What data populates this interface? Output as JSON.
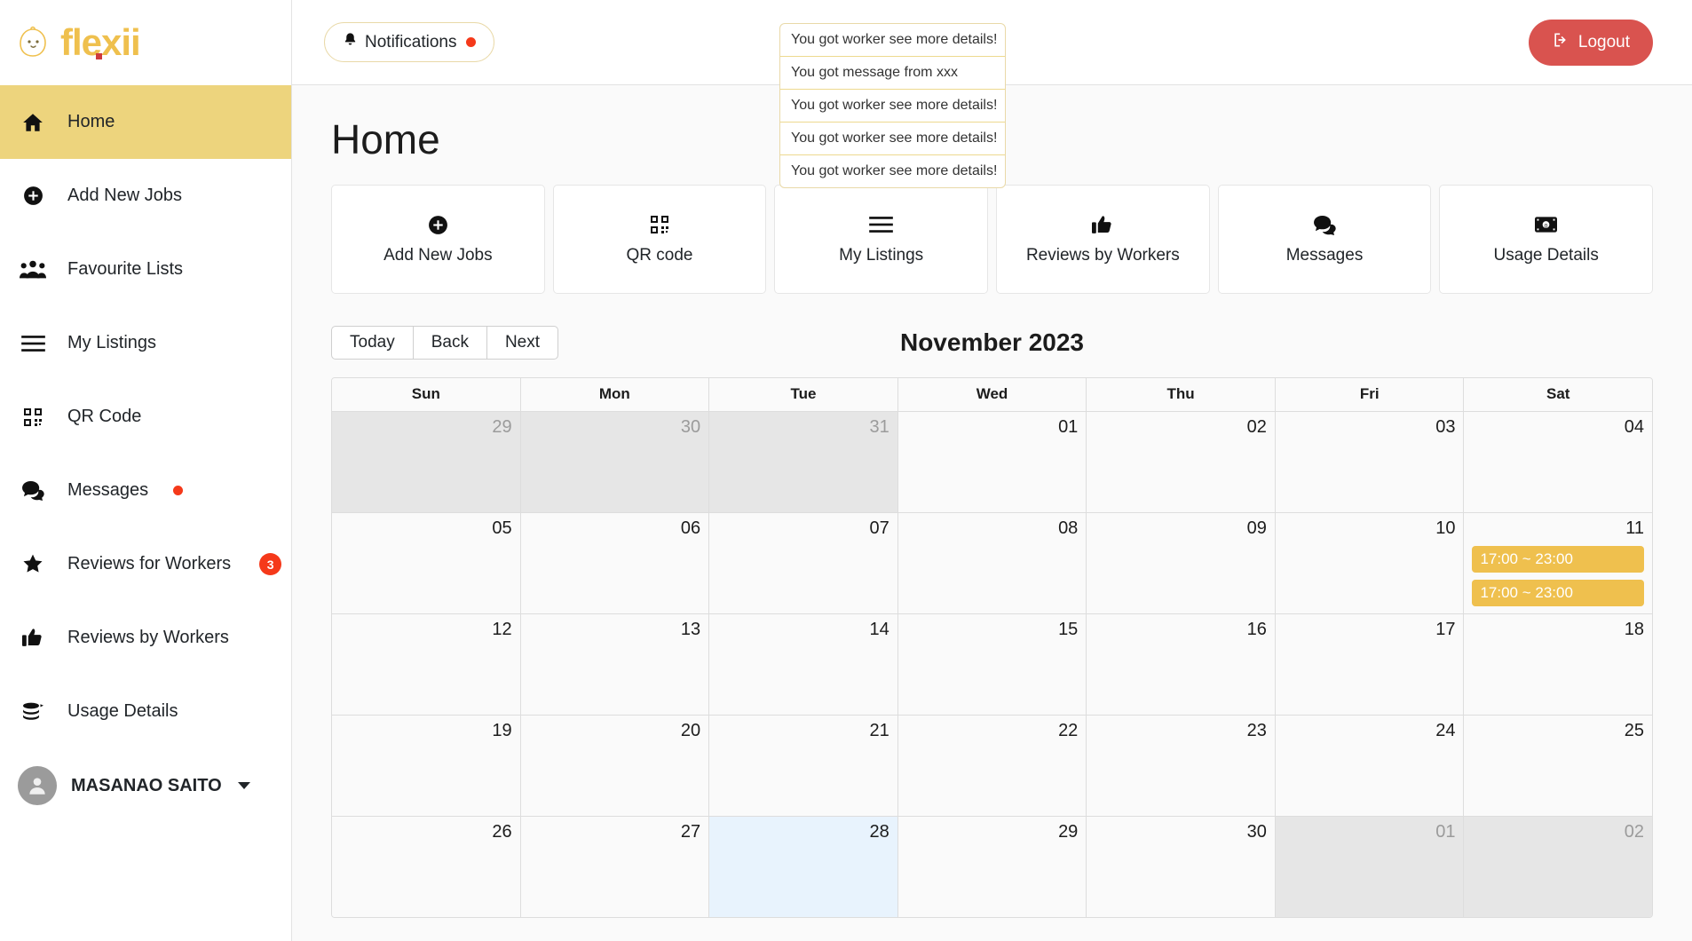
{
  "brand": {
    "name": "flexii",
    "mascot_icon": "chick-icon",
    "accent": "#efc04e",
    "dot_color": "#cf3b3b"
  },
  "sidebar": {
    "items": [
      {
        "label": "Home",
        "icon": "home-icon",
        "active": true
      },
      {
        "label": "Add New Jobs",
        "icon": "plus-circle-icon",
        "active": false
      },
      {
        "label": "Favourite Lists",
        "icon": "people-group-icon",
        "active": false
      },
      {
        "label": "My Listings",
        "icon": "list-lines-icon",
        "active": false
      },
      {
        "label": "QR Code",
        "icon": "qr-code-icon",
        "active": false
      },
      {
        "label": "Messages",
        "icon": "chat-bubbles-icon",
        "active": false,
        "dot": true
      },
      {
        "label": "Reviews for Workers",
        "icon": "star-icon",
        "active": false,
        "badge": "3"
      },
      {
        "label": "Reviews by Workers",
        "icon": "thumbs-up-icon",
        "active": false
      },
      {
        "label": "Usage Details",
        "icon": "coins-icon",
        "active": false
      }
    ],
    "profile": {
      "name": "MASANAO SAITO",
      "avatar_icon": "user-avatar-icon",
      "caret_icon": "caret-down-icon"
    }
  },
  "topbar": {
    "notifications_label": "Notifications",
    "notifications_icon": "bell-icon",
    "notifications_has_unread": true,
    "logout_label": "Logout",
    "logout_icon": "sign-out-icon",
    "logout_color": "#d9534f"
  },
  "notifications": {
    "items": [
      "You got worker see more details!",
      "You got message from xxx",
      "You got worker see more details!",
      "You got worker see more details!",
      "You got worker see more details!"
    ]
  },
  "main": {
    "page_title": "Home",
    "cards": [
      {
        "label": "Add New Jobs",
        "icon": "plus-circle-icon"
      },
      {
        "label": "QR code",
        "icon": "qr-code-icon"
      },
      {
        "label": "My Listings",
        "icon": "list-lines-icon"
      },
      {
        "label": "Reviews by Workers",
        "icon": "thumbs-up-icon"
      },
      {
        "label": "Messages",
        "icon": "chat-bubbles-icon"
      },
      {
        "label": "Usage Details",
        "icon": "money-bill-icon"
      }
    ]
  },
  "calendar": {
    "toolbar": {
      "today": "Today",
      "back": "Back",
      "next": "Next"
    },
    "title": "November 2023",
    "weekdays": [
      "Sun",
      "Mon",
      "Tue",
      "Wed",
      "Thu",
      "Fri",
      "Sat"
    ],
    "event_color": "#efc04e",
    "today_cell_color": "#e8f3fd",
    "weeks": [
      [
        {
          "date": "29",
          "off": true,
          "today": false,
          "events": []
        },
        {
          "date": "30",
          "off": true,
          "today": false,
          "events": []
        },
        {
          "date": "31",
          "off": true,
          "today": false,
          "events": []
        },
        {
          "date": "01",
          "off": false,
          "today": false,
          "events": []
        },
        {
          "date": "02",
          "off": false,
          "today": false,
          "events": []
        },
        {
          "date": "03",
          "off": false,
          "today": false,
          "events": []
        },
        {
          "date": "04",
          "off": false,
          "today": false,
          "events": []
        }
      ],
      [
        {
          "date": "05",
          "off": false,
          "today": false,
          "events": []
        },
        {
          "date": "06",
          "off": false,
          "today": false,
          "events": []
        },
        {
          "date": "07",
          "off": false,
          "today": false,
          "events": []
        },
        {
          "date": "08",
          "off": false,
          "today": false,
          "events": []
        },
        {
          "date": "09",
          "off": false,
          "today": false,
          "events": []
        },
        {
          "date": "10",
          "off": false,
          "today": false,
          "events": []
        },
        {
          "date": "11",
          "off": false,
          "today": false,
          "events": [
            "17:00 ~ 23:00",
            "17:00 ~ 23:00"
          ]
        }
      ],
      [
        {
          "date": "12",
          "off": false,
          "today": false,
          "events": []
        },
        {
          "date": "13",
          "off": false,
          "today": false,
          "events": []
        },
        {
          "date": "14",
          "off": false,
          "today": false,
          "events": []
        },
        {
          "date": "15",
          "off": false,
          "today": false,
          "events": []
        },
        {
          "date": "16",
          "off": false,
          "today": false,
          "events": []
        },
        {
          "date": "17",
          "off": false,
          "today": false,
          "events": []
        },
        {
          "date": "18",
          "off": false,
          "today": false,
          "events": []
        }
      ],
      [
        {
          "date": "19",
          "off": false,
          "today": false,
          "events": []
        },
        {
          "date": "20",
          "off": false,
          "today": false,
          "events": []
        },
        {
          "date": "21",
          "off": false,
          "today": false,
          "events": []
        },
        {
          "date": "22",
          "off": false,
          "today": false,
          "events": []
        },
        {
          "date": "23",
          "off": false,
          "today": false,
          "events": []
        },
        {
          "date": "24",
          "off": false,
          "today": false,
          "events": []
        },
        {
          "date": "25",
          "off": false,
          "today": false,
          "events": []
        }
      ],
      [
        {
          "date": "26",
          "off": false,
          "today": false,
          "events": []
        },
        {
          "date": "27",
          "off": false,
          "today": false,
          "events": []
        },
        {
          "date": "28",
          "off": false,
          "today": true,
          "events": []
        },
        {
          "date": "29",
          "off": false,
          "today": false,
          "events": []
        },
        {
          "date": "30",
          "off": false,
          "today": false,
          "events": []
        },
        {
          "date": "01",
          "off": true,
          "today": false,
          "events": []
        },
        {
          "date": "02",
          "off": true,
          "today": false,
          "events": []
        }
      ]
    ]
  }
}
